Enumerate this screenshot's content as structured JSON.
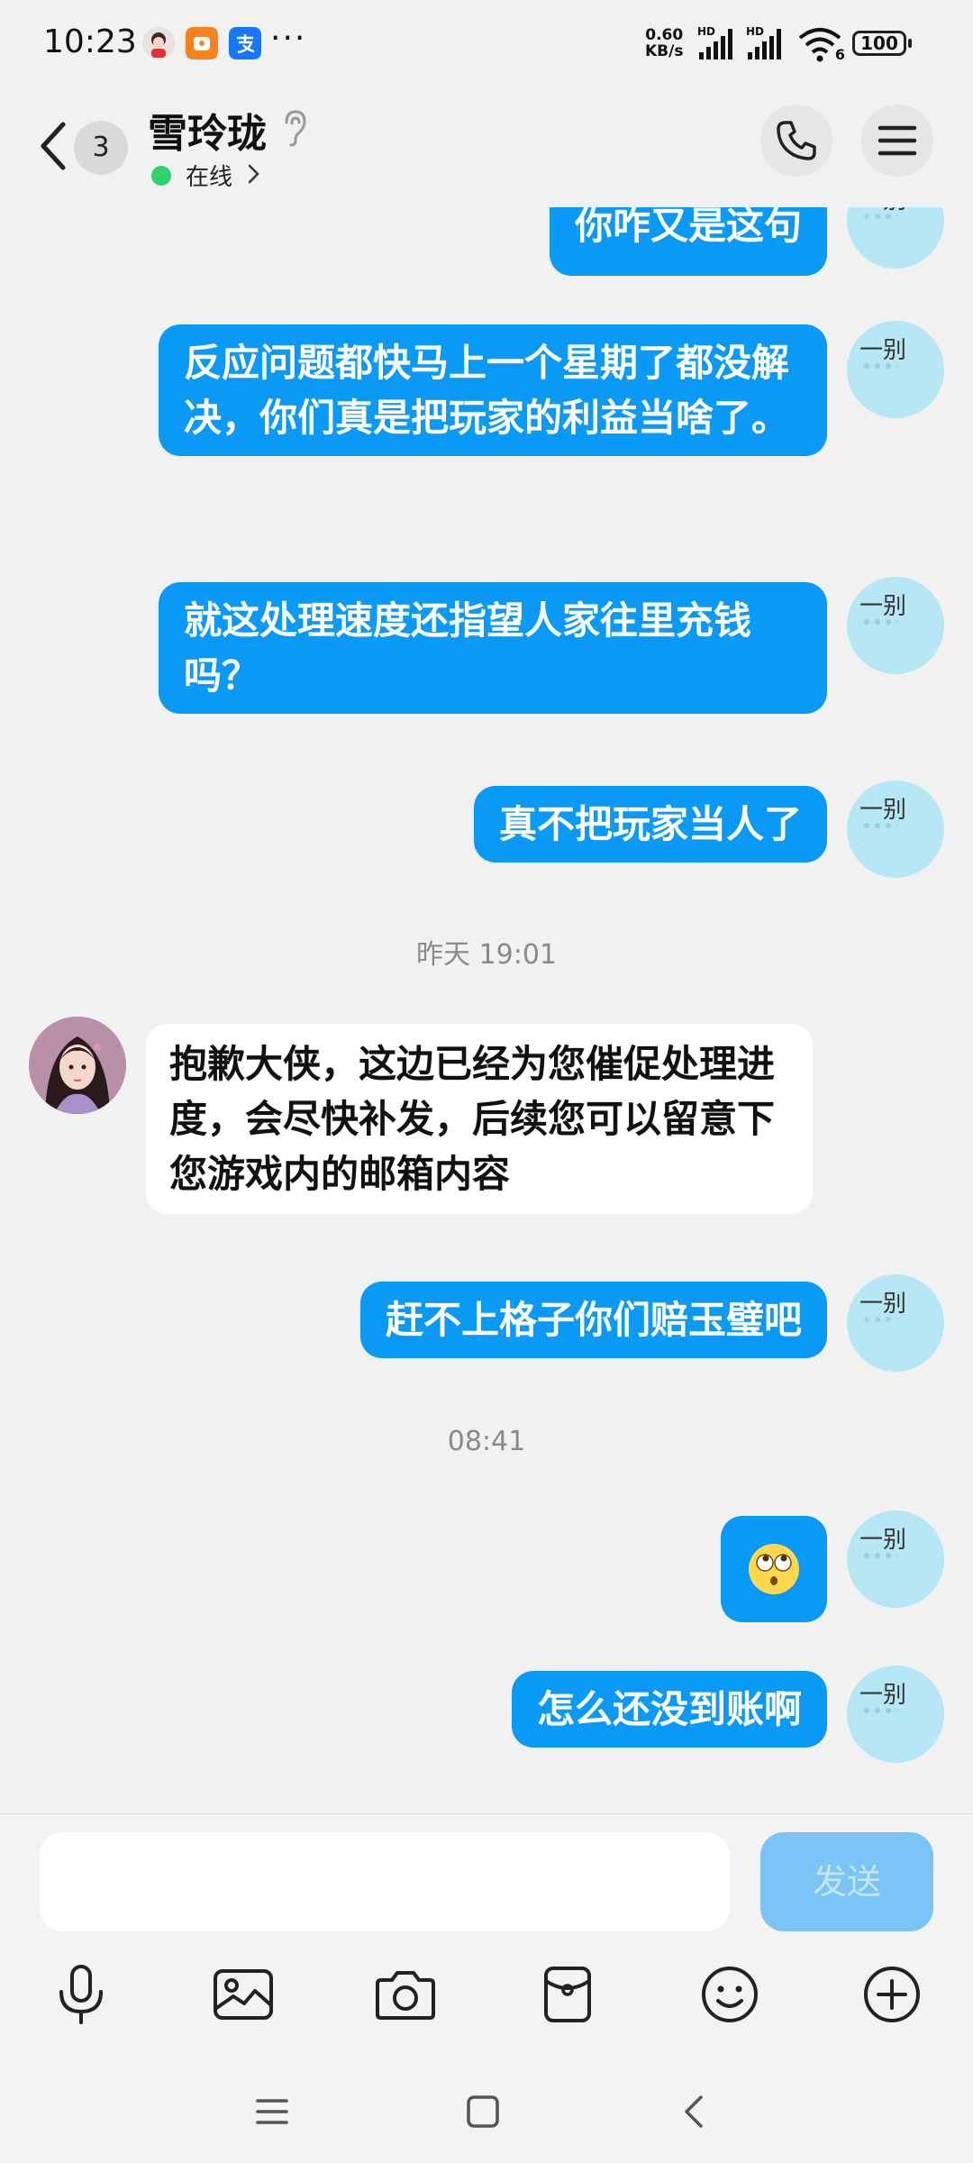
{
  "status_bar": {
    "time": "10:23",
    "more": "···",
    "net_speed_value": "0.60",
    "net_speed_unit": "KB/s",
    "signal_tag": "HD",
    "wifi_badge": "6",
    "battery": "100"
  },
  "header": {
    "unread_count": "3",
    "contact_name": "雪玲珑",
    "status_text": "在线"
  },
  "my_avatar_label": "一别",
  "messages": [
    {
      "text": "你咋又是这句"
    },
    {
      "text": "反应问题都快马上一个星期了都没解决，你们真是把玩家的利益当啥了。"
    },
    {
      "text": "就这处理速度还指望人家往里充钱吗？"
    },
    {
      "text": "真不把玩家当人了"
    },
    {
      "text": "抱歉大侠，这边已经为您催促处理进度，会尽快补发，后续您可以留意下您游戏内的邮箱内容"
    },
    {
      "text": "赶不上格子你们赔玉璧吧"
    },
    {
      "text": "怎么还没到账啊"
    }
  ],
  "timestamps": [
    "昨天 19:01",
    "08:41"
  ],
  "input": {
    "placeholder": "",
    "send_label": "发送"
  }
}
